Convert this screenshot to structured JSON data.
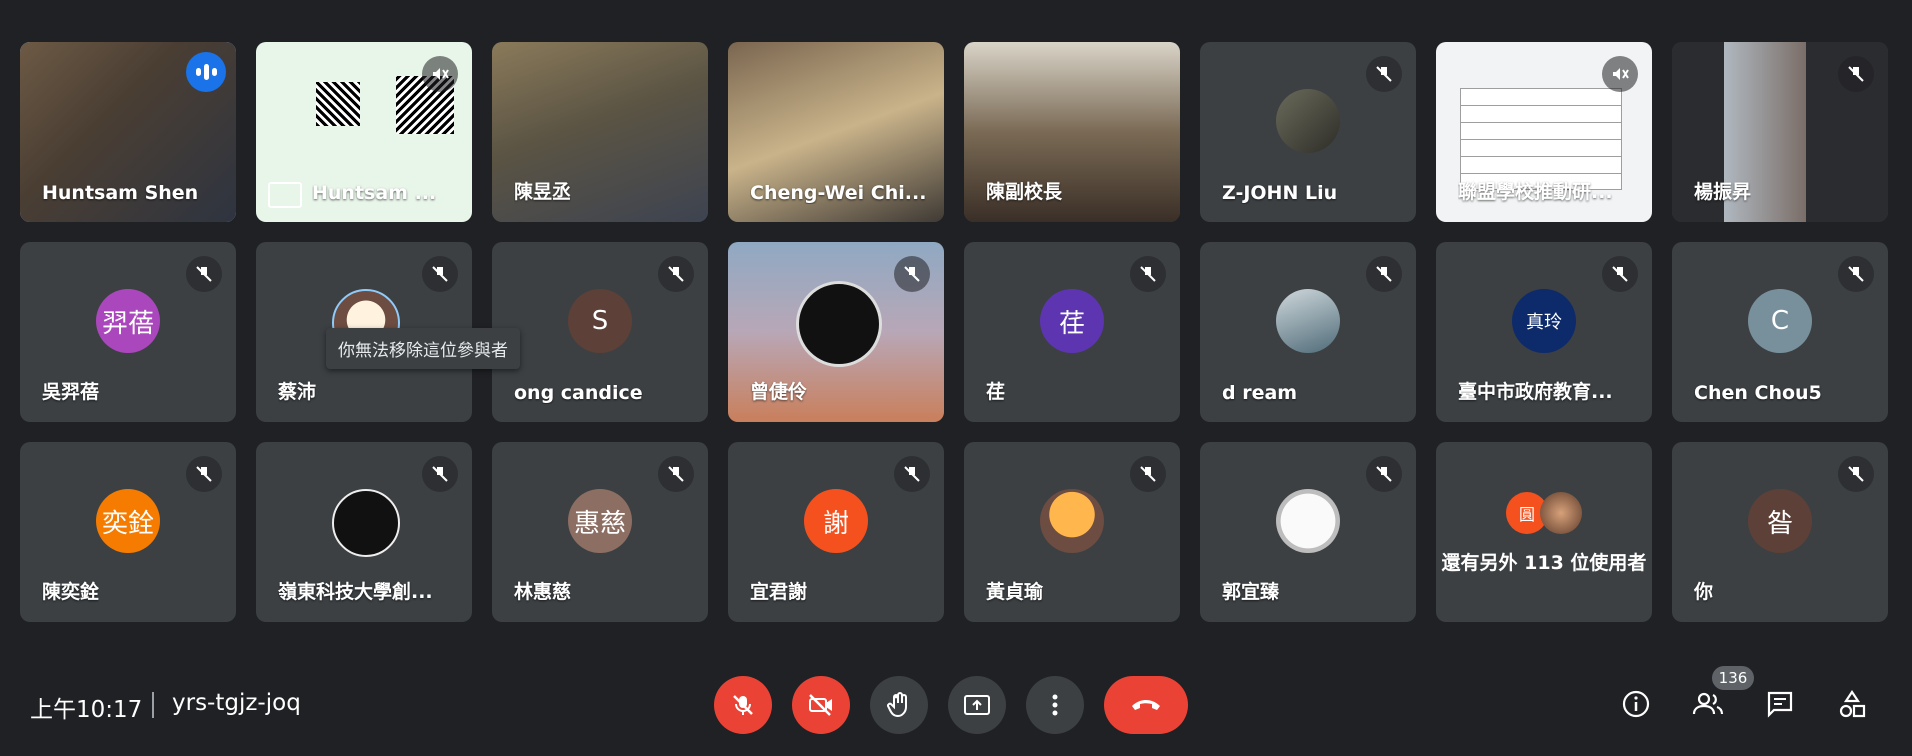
{
  "meeting": {
    "time": "上午10:17",
    "code": "yrs-tgjz-joq",
    "people_count": "136"
  },
  "tooltip": "你無法移除這位參與者",
  "others": {
    "label": "還有另外 113 位使用者",
    "avatar_letter": "圓"
  },
  "participants": [
    {
      "name": "Huntsam Shen",
      "type": "video",
      "speaking": true
    },
    {
      "name": "Huntsam ...",
      "type": "presentation"
    },
    {
      "name": "陳昱丞",
      "type": "video"
    },
    {
      "name": "Cheng-Wei Chi...",
      "type": "video"
    },
    {
      "name": "陳副校長",
      "type": "video"
    },
    {
      "name": "Z-JOHN Liu",
      "type": "photo"
    },
    {
      "name": "聯盟學校推動研...",
      "type": "screen"
    },
    {
      "name": "楊振昇",
      "type": "video"
    },
    {
      "name": "吳羿蓓",
      "type": "avatar",
      "initials": "羿蓓",
      "color": "#ab47bc"
    },
    {
      "name": "蔡沛",
      "type": "photo"
    },
    {
      "name": "ong candice",
      "type": "avatar",
      "initials": "S",
      "color": "#5d4037"
    },
    {
      "name": "曾倢伶",
      "type": "gradient"
    },
    {
      "name": "荏",
      "type": "avatar",
      "initials": "荏",
      "color": "#5e35b1"
    },
    {
      "name": "d ream",
      "type": "photo"
    },
    {
      "name": "臺中市政府教育...",
      "type": "logo",
      "initials": "真玲"
    },
    {
      "name": "Chen Chou5",
      "type": "avatar",
      "initials": "C",
      "color": "#78909c"
    },
    {
      "name": "陳奕銓",
      "type": "avatar",
      "initials": "奕銓",
      "color": "#f57c00"
    },
    {
      "name": "嶺東科技大學創...",
      "type": "logo2"
    },
    {
      "name": "林惠慈",
      "type": "avatar",
      "initials": "惠慈",
      "color": "#8d6e63"
    },
    {
      "name": "宜君謝",
      "type": "avatar",
      "initials": "謝",
      "color": "#f4511e"
    },
    {
      "name": "黃貞瑜",
      "type": "photo"
    },
    {
      "name": "郭宜臻",
      "type": "photo"
    },
    {
      "name": "",
      "type": "others"
    },
    {
      "name": "你",
      "type": "avatar",
      "initials": "昝",
      "color": "#5d4037"
    }
  ],
  "colors": {
    "accent": "#8ab4f8",
    "danger": "#ea4335",
    "tile": "#3c4043",
    "bg": "#202124"
  },
  "icons": [
    "mic-off-icon",
    "video-off-icon",
    "raise-hand-icon",
    "present-icon",
    "more-icon",
    "end-call-icon",
    "info-icon",
    "people-icon",
    "chat-icon",
    "activities-icon"
  ]
}
